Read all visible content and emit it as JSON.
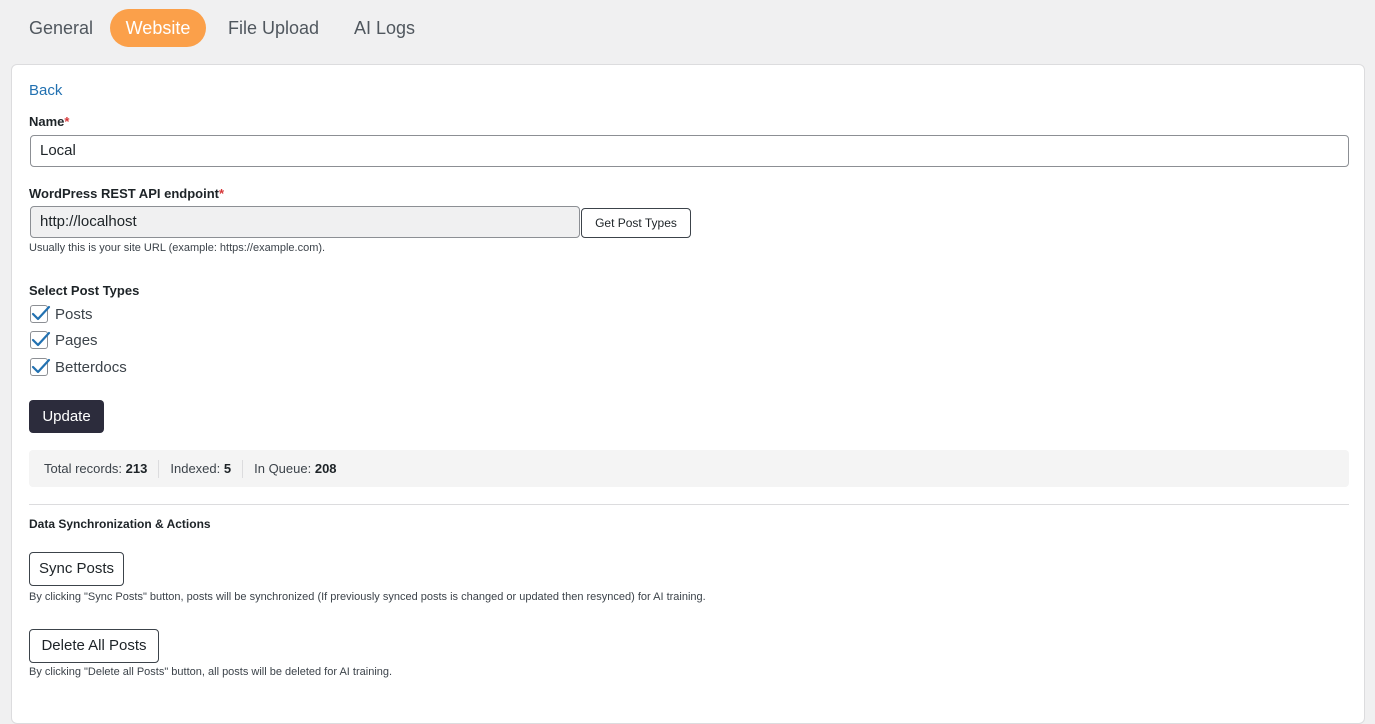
{
  "tabs": [
    {
      "label": "General",
      "active": false
    },
    {
      "label": "Website",
      "active": true
    },
    {
      "label": "File Upload",
      "active": false
    },
    {
      "label": "AI Logs",
      "active": false
    }
  ],
  "colors": {
    "accent": "#fba04a",
    "link": "#2271b1",
    "primary_button": "#2c2c3c",
    "required": "#d63638"
  },
  "back_label": "Back",
  "form": {
    "name": {
      "label": "Name",
      "required_mark": "*",
      "value": "Local"
    },
    "endpoint": {
      "label": "WordPress REST API endpoint",
      "required_mark": "*",
      "value": "http://localhost",
      "button": "Get Post Types",
      "hint": "Usually this is your site URL (example: https://example.com)."
    },
    "post_types": {
      "label": "Select Post Types",
      "items": [
        {
          "label": "Posts",
          "checked": true
        },
        {
          "label": "Pages",
          "checked": true
        },
        {
          "label": "Betterdocs",
          "checked": true
        }
      ]
    },
    "update_button": "Update"
  },
  "stats": {
    "total_label": "Total records:",
    "total_value": "213",
    "indexed_label": "Indexed:",
    "indexed_value": "5",
    "queue_label": "In Queue:",
    "queue_value": "208"
  },
  "sync": {
    "title": "Data Synchronization & Actions",
    "sync_button": "Sync Posts",
    "sync_hint": "By clicking \"Sync Posts\" button, posts will be synchronized (If previously synced posts is changed or updated then resynced) for AI training.",
    "delete_button": "Delete All Posts",
    "delete_hint": "By clicking \"Delete all Posts\" button, all posts will be deleted for AI training."
  }
}
